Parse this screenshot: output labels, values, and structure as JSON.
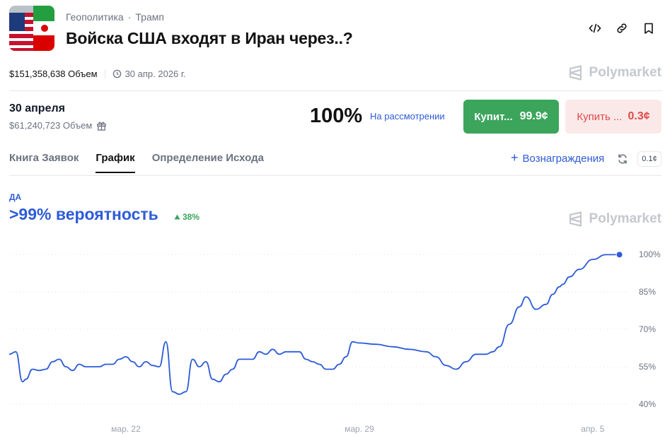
{
  "header": {
    "breadcrumb": [
      "Геополитика",
      "Трамп"
    ],
    "breadcrumb_sep": "·",
    "title": "Войска США входят в Иран через..?",
    "actions": [
      "embed-icon",
      "link-icon",
      "bookmark-icon"
    ]
  },
  "meta": {
    "volume": "$151,358,638 Объем",
    "end_date": "30 апр. 2026 г."
  },
  "brand": "Polymarket",
  "outcome": {
    "date": "30 апреля",
    "volume": "$61,240,723 Объем",
    "probability": "100%",
    "status": "На рассмотрении",
    "yes_label": "Купит...",
    "yes_price": "99.9¢",
    "no_label": "Купить ...",
    "no_price": "0.3¢"
  },
  "tabs": [
    {
      "label": "Книга Заявок",
      "active": false
    },
    {
      "label": "График",
      "active": true
    },
    {
      "label": "Определение Исхода",
      "active": false
    }
  ],
  "rewards": {
    "plus": "+",
    "label": "Вознаграждения"
  },
  "tick": "0.1¢",
  "colors": {
    "accent": "#2d5bd7",
    "yes": "#3ba55c",
    "no": "#e04848"
  },
  "chart_data": {
    "type": "line",
    "series_label": "ДА",
    "headline": ">99% вероятность",
    "change": "38%",
    "y_ticks": [
      "100%",
      "85%",
      "70%",
      "55%",
      "40%"
    ],
    "y_tick_values": [
      100,
      85,
      70,
      55,
      40
    ],
    "ylim": [
      40,
      100
    ],
    "x_ticks": [
      "мар. 22",
      "мар. 29",
      "апр. 5"
    ],
    "x_tick_positions": [
      3,
      10,
      17
    ],
    "xlim": [
      -0.5,
      18
    ],
    "grid": true,
    "x": [
      -0.5,
      -0.3,
      -0.1,
      0,
      0.2,
      0.4,
      0.6,
      0.8,
      1.0,
      1.2,
      1.4,
      1.6,
      1.8,
      2.0,
      2.2,
      2.4,
      2.6,
      2.8,
      3.0,
      3.2,
      3.4,
      3.6,
      3.8,
      4.0,
      4.2,
      4.4,
      4.6,
      4.8,
      5.0,
      5.2,
      5.4,
      5.6,
      5.8,
      6.0,
      6.2,
      6.4,
      6.6,
      6.8,
      7.0,
      7.2,
      7.4,
      7.6,
      7.8,
      8.0,
      8.2,
      8.4,
      8.6,
      8.8,
      9.0,
      9.2,
      9.4,
      9.6,
      9.8,
      10.0,
      10.5,
      11.0,
      11.5,
      12.0,
      12.3,
      12.6,
      12.9,
      13.2,
      13.5,
      13.8,
      14.0,
      14.2,
      14.5,
      14.8,
      15.0,
      15.3,
      15.6,
      15.8,
      16.0,
      16.1,
      16.3,
      16.6,
      17.0,
      17.4,
      17.8
    ],
    "y": [
      60,
      61,
      49,
      50,
      54,
      53.5,
      54,
      57,
      58,
      55,
      53.5,
      56,
      55,
      55,
      55,
      56,
      56,
      58,
      59,
      57,
      55,
      57,
      55.5,
      55,
      65,
      45,
      44,
      45,
      58,
      55,
      57,
      50,
      49,
      52,
      54,
      58,
      58,
      58,
      61,
      60,
      62,
      60,
      61,
      61,
      61,
      58,
      57,
      56,
      54,
      54,
      56,
      59,
      65,
      64.5,
      64,
      63,
      62,
      61,
      59,
      55.5,
      54,
      57,
      60,
      60,
      61,
      63,
      72,
      79,
      83,
      78,
      80,
      84,
      87,
      88,
      91,
      94,
      98,
      99.9,
      99.9
    ]
  }
}
